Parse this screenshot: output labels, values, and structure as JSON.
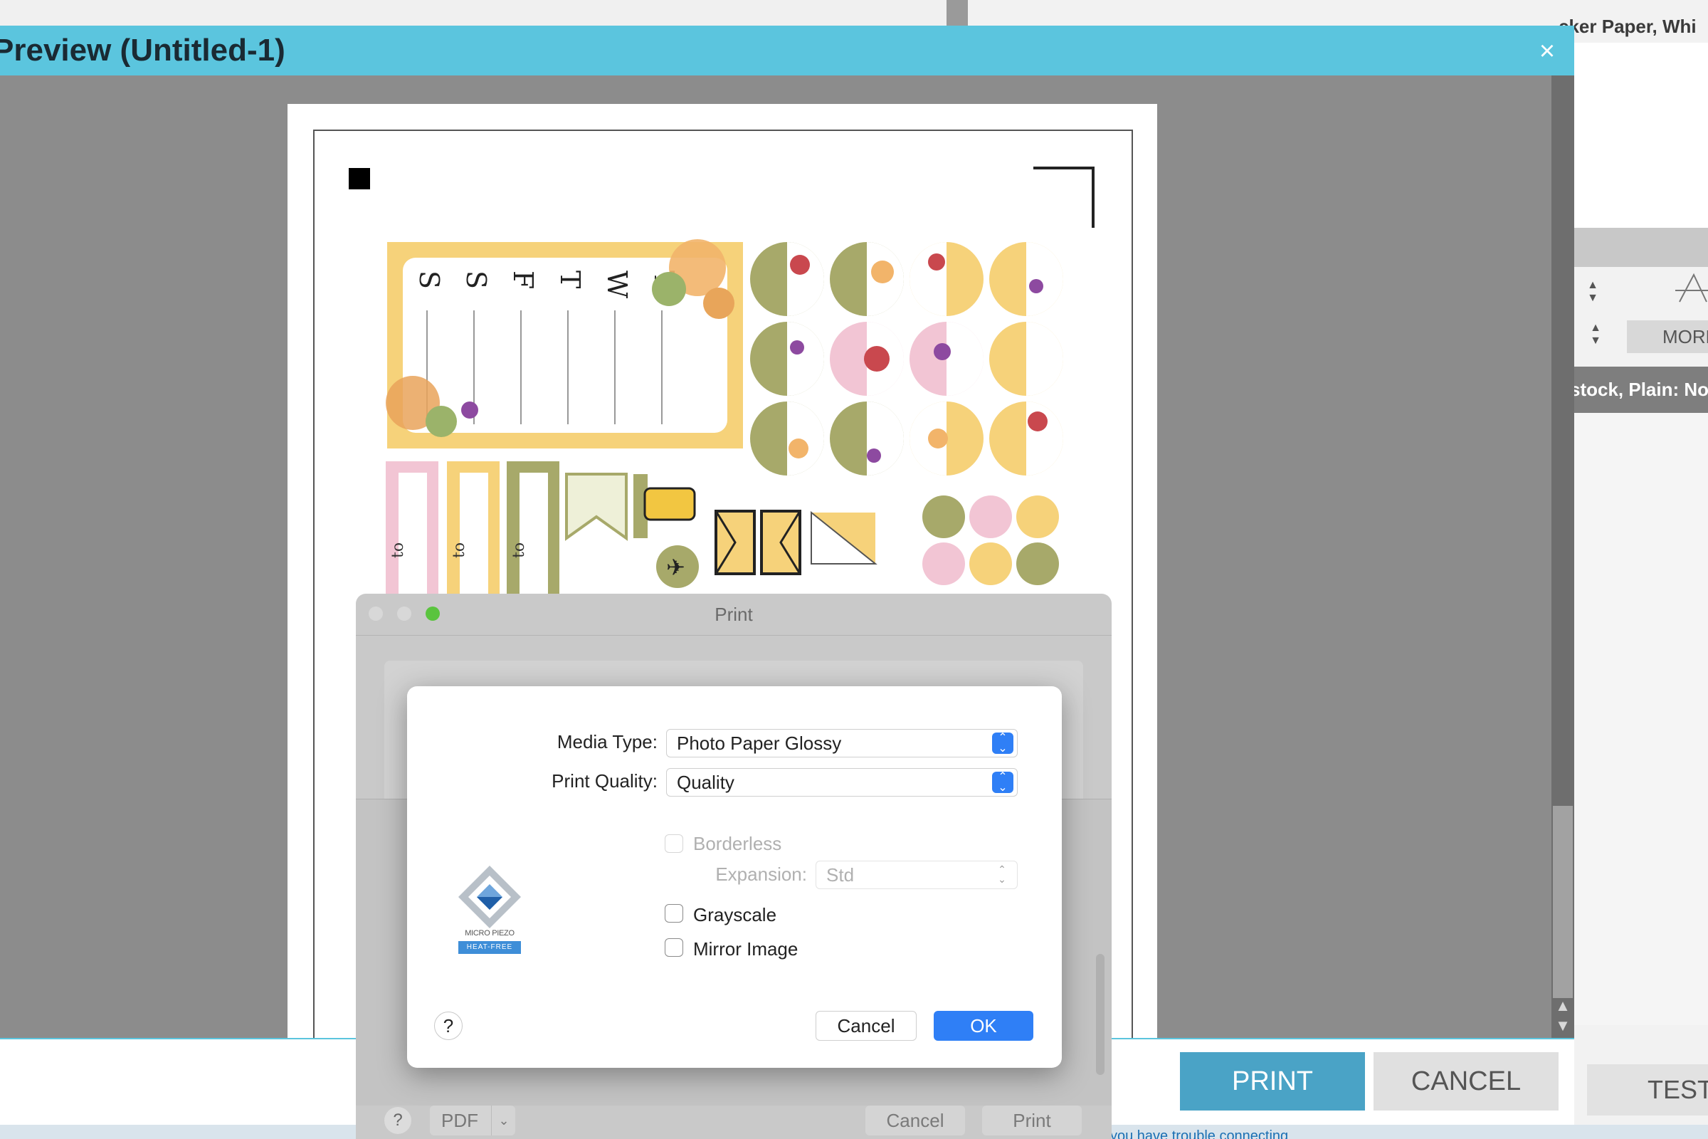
{
  "background": {
    "top_right_label": "cker Paper, Whi",
    "band_label": "stock, Plain: No",
    "more_label": "MORE",
    "test_label": "TEST",
    "status_text": "you have trouble connecting"
  },
  "preview": {
    "title": "Preview (Untitled-1)",
    "close_icon": "×",
    "print_label": "PRINT",
    "cancel_label": "CANCEL"
  },
  "print_dialog": {
    "title": "Print",
    "help_label": "?",
    "pdf_label": "PDF",
    "cancel_label": "Cancel",
    "print_label": "Print"
  },
  "media_sheet": {
    "media_type_label": "Media Type:",
    "media_type_value": "Photo Paper Glossy",
    "print_quality_label": "Print Quality:",
    "print_quality_value": "Quality",
    "borderless_label": "Borderless",
    "expansion_label": "Expansion:",
    "expansion_value": "Std",
    "grayscale_label": "Grayscale",
    "mirror_label": "Mirror Image",
    "help_label": "?",
    "cancel_label": "Cancel",
    "ok_label": "OK",
    "logo_text": "MICRO PIEZO",
    "logo_badge": "HEAT-FREE",
    "checkboxes": {
      "borderless": false,
      "grayscale": false,
      "mirror": false
    }
  },
  "stickers": {
    "weekdays": [
      "S",
      "S",
      "F",
      "T",
      "W",
      "T"
    ],
    "tab_text": "to"
  },
  "colors": {
    "titlebar": "#5bc5de",
    "accent_blue": "#2f7ff6",
    "print_button": "#4aa3c6",
    "sticker_yellow": "#f6d27a",
    "sticker_olive": "#a7a96a",
    "sticker_pink": "#f2c5d4"
  }
}
